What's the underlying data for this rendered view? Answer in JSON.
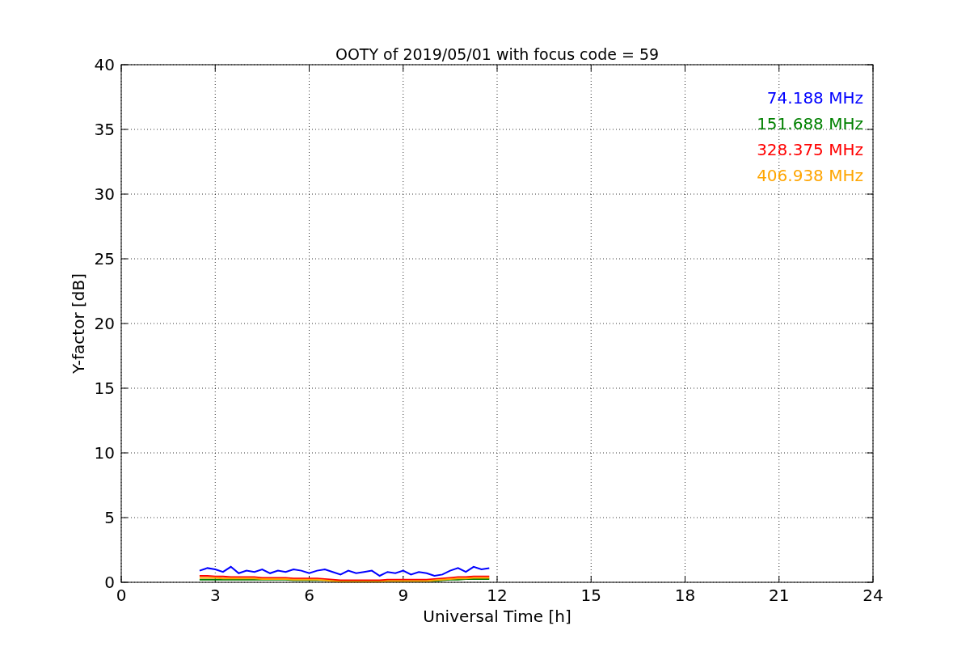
{
  "figure": {
    "chart_data": {
      "type": "line",
      "title": "OOTY of 2019/05/01 with focus code = 59",
      "xlabel": "Universal Time [h]",
      "ylabel": "Y-factor [dB]",
      "x": [
        2.5,
        2.75,
        3,
        3.25,
        3.5,
        3.75,
        4,
        4.25,
        4.5,
        4.75,
        5,
        5.25,
        5.5,
        5.75,
        6,
        6.25,
        6.5,
        6.75,
        7,
        7.25,
        7.5,
        7.75,
        8,
        8.25,
        8.5,
        8.75,
        9,
        9.25,
        9.5,
        9.75,
        10,
        10.25,
        10.5,
        10.75,
        11,
        11.25,
        11.5,
        11.75
      ],
      "series": [
        {
          "name": "74.188 MHz",
          "color": "#0000ff",
          "values": [
            0.9,
            1.1,
            1.0,
            0.8,
            1.2,
            0.7,
            0.9,
            0.8,
            1.0,
            0.7,
            0.9,
            0.8,
            1.0,
            0.9,
            0.7,
            0.9,
            1.0,
            0.8,
            0.6,
            0.9,
            0.7,
            0.8,
            0.9,
            0.5,
            0.8,
            0.7,
            0.9,
            0.6,
            0.8,
            0.7,
            0.5,
            0.6,
            0.9,
            1.1,
            0.8,
            1.2,
            1.0,
            1.1
          ]
        },
        {
          "name": "151.688 MHz",
          "color": "#008000",
          "values": [
            0.2,
            0.2,
            0.2,
            0.2,
            0.2,
            0.2,
            0.2,
            0.2,
            0.2,
            0.2,
            0.2,
            0.2,
            0.15,
            0.15,
            0.15,
            0.15,
            0.15,
            0.1,
            0.1,
            0.1,
            0.1,
            0.1,
            0.1,
            0.1,
            0.1,
            0.1,
            0.1,
            0.1,
            0.1,
            0.1,
            0.1,
            0.15,
            0.2,
            0.2,
            0.25,
            0.25,
            0.25,
            0.25
          ]
        },
        {
          "name": "328.375 MHz",
          "color": "#ff0000",
          "values": [
            0.5,
            0.5,
            0.45,
            0.45,
            0.4,
            0.4,
            0.4,
            0.4,
            0.35,
            0.35,
            0.35,
            0.35,
            0.3,
            0.3,
            0.3,
            0.3,
            0.25,
            0.2,
            0.15,
            0.15,
            0.15,
            0.15,
            0.15,
            0.15,
            0.2,
            0.2,
            0.2,
            0.2,
            0.2,
            0.2,
            0.25,
            0.3,
            0.35,
            0.4,
            0.4,
            0.45,
            0.45,
            0.45
          ]
        },
        {
          "name": "406.938 MHz",
          "color": "#ffa500",
          "values": [
            0.35,
            0.35,
            0.35,
            0.3,
            0.3,
            0.3,
            0.3,
            0.3,
            0.25,
            0.25,
            0.25,
            0.25,
            0.2,
            0.2,
            0.2,
            0.2,
            0.15,
            0.1,
            0.05,
            0.05,
            0.05,
            0.05,
            0.05,
            0.05,
            0.1,
            0.1,
            0.1,
            0.1,
            0.1,
            0.1,
            0.15,
            0.2,
            0.25,
            0.3,
            0.3,
            0.35,
            0.35,
            0.35
          ]
        }
      ],
      "grid": true,
      "xlim": [
        0,
        24
      ],
      "ylim": [
        0,
        40
      ],
      "xticks": [
        0,
        3,
        6,
        9,
        12,
        15,
        18,
        21,
        24
      ],
      "yticks": [
        0,
        5,
        10,
        15,
        20,
        25,
        30,
        35,
        40
      ]
    }
  }
}
